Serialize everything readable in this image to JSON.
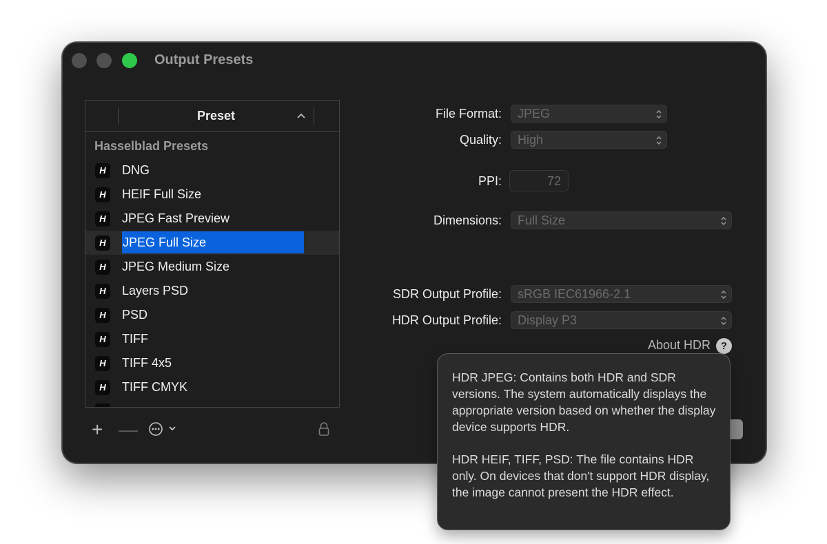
{
  "window": {
    "title": "Output Presets"
  },
  "table": {
    "column_header": "Preset",
    "group_label": "Hasselblad Presets",
    "badge": "H",
    "rows": [
      {
        "label": "DNG"
      },
      {
        "label": "HEIF Full Size"
      },
      {
        "label": "JPEG Fast Preview"
      },
      {
        "label": "JPEG Full Size",
        "selected": true
      },
      {
        "label": "JPEG Medium Size"
      },
      {
        "label": "Layers PSD"
      },
      {
        "label": "PSD"
      },
      {
        "label": "TIFF"
      },
      {
        "label": "TIFF 4x5"
      },
      {
        "label": "TIFF CMYK"
      }
    ]
  },
  "toolbar": {
    "add": "+",
    "remove": "—"
  },
  "form": {
    "file_format": {
      "label": "File Format:",
      "value": "JPEG"
    },
    "quality": {
      "label": "Quality:",
      "value": "High"
    },
    "ppi": {
      "label": "PPI:",
      "value": "72"
    },
    "dimensions": {
      "label": "Dimensions:",
      "value": "Full Size"
    },
    "sdr_profile": {
      "label": "SDR Output Profile:",
      "value": "sRGB IEC61966-2.1"
    },
    "hdr_profile": {
      "label": "HDR Output Profile:",
      "value": "Display P3"
    },
    "about_hdr": "About HDR",
    "help_glyph": "?"
  },
  "tooltip": {
    "para1": "HDR JPEG: Contains both HDR and SDR versions. The system automatically displays the appropriate version based on whether the display device supports HDR.",
    "para2": "HDR HEIF, TIFF, PSD: The file contains HDR only. On devices that don't support HDR display, the image cannot present the HDR effect."
  },
  "colors": {
    "window_bg": "#1e1e1e",
    "selection": "#0a63dc",
    "zoom_green": "#2fc84a"
  },
  "icons": [
    "hasselblad-h-icon",
    "sort-ascending-icon",
    "add-icon",
    "remove-icon",
    "more-options-icon",
    "chevron-down-icon",
    "lock-icon",
    "popup-arrows-icon",
    "help-icon"
  ]
}
